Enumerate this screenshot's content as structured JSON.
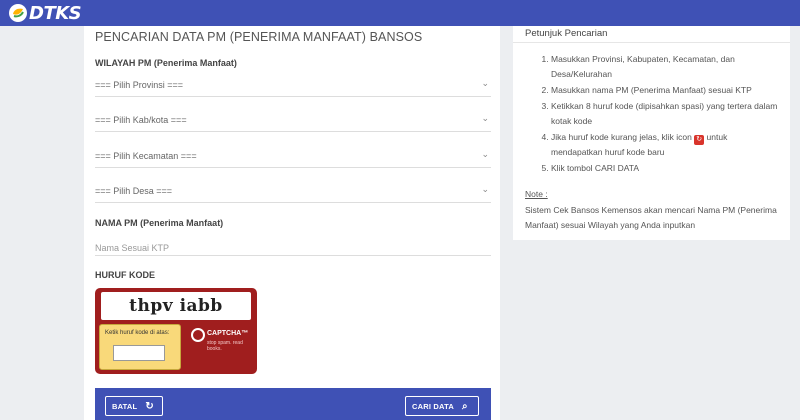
{
  "app": {
    "logo_text": "DTKS",
    "accent": "#3f51b5"
  },
  "form": {
    "title": "PENCARIAN DATA PM (PENERIMA MANFAAT) BANSOS",
    "wilayah_label": "WILAYAH PM (Penerima Manfaat)",
    "provinsi": "=== Pilih Provinsi ===",
    "kabkota": "=== Pilih Kab/kota ===",
    "kecamatan": "=== Pilih Kecamatan ===",
    "desa": "=== Pilih Desa ===",
    "nama_label": "NAMA PM (Penerima Manfaat)",
    "nama_placeholder": "Nama Sesuai KTP",
    "kode_label": "HURUF KODE",
    "captcha_text": "thpv iabb",
    "captcha_hint": "Ketik huruf kode di atas:",
    "captcha_brand": "CAPTCHA™",
    "captcha_tagline": "stop spam. read books.",
    "btn_batal": "BATAL",
    "btn_cari": "CARI DATA"
  },
  "help": {
    "title": "Petunjuk Pencarian",
    "steps": [
      "Masukkan Provinsi, Kabupaten, Kecamatan, dan Desa/Kelurahan",
      "Masukkan nama PM (Penerima Manfaat) sesuai KTP",
      "Ketikkan 8 huruf kode (dipisahkan spasi) yang tertera dalam kotak kode",
      "Jika huruf kode kurang jelas, klik icon",
      "untuk mendapatkan huruf kode baru",
      "Klik tombol CARI DATA"
    ],
    "note_heading": "Note :",
    "note_text": "Sistem Cek Bansos Kemensos akan mencari Nama PM (Penerima Manfaat) sesuai Wilayah yang Anda inputkan"
  }
}
